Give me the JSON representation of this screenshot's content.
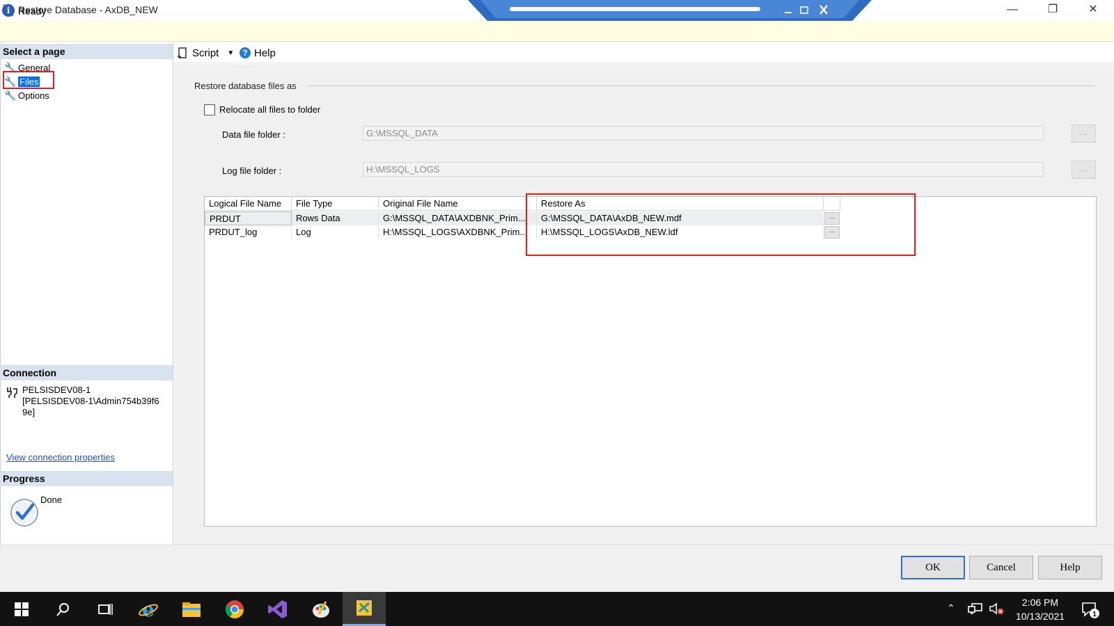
{
  "window": {
    "title": "Restore Database - AxDB_NEW"
  },
  "status": {
    "text": "Ready"
  },
  "left": {
    "select_page_header": "Select a page",
    "pages": [
      "General",
      "Files",
      "Options"
    ],
    "connection_header": "Connection",
    "connection_lines": [
      "PELSISDEV08-1",
      "[PELSISDEV08-1\\Admin754b39f6",
      "9e]"
    ],
    "connection_link": "View connection properties",
    "progress_header": "Progress",
    "progress_text": "Done"
  },
  "toolbar": {
    "script_label": "Script",
    "help_label": "Help"
  },
  "main": {
    "group_label": "Restore database files as",
    "relocate_label": "Relocate all files to folder",
    "data_folder_label": "Data file folder :",
    "data_folder_value": "G:\\MSSQL_DATA",
    "log_folder_label": "Log file folder :",
    "log_folder_value": "H:\\MSSQL_LOGS",
    "browse_label": "...",
    "grid": {
      "columns": [
        "Logical File Name",
        "File Type",
        "Original File Name",
        "Restore As"
      ],
      "rows": [
        [
          "PRDUT",
          "Rows Data",
          "G:\\MSSQL_DATA\\AXDBNK_Prim...",
          "G:\\MSSQL_DATA\\AxDB_NEW.mdf"
        ],
        [
          "PRDUT_log",
          "Log",
          "H:\\MSSQL_LOGS\\AXDBNK_Prim...",
          "H:\\MSSQL_LOGS\\AxDB_NEW.ldf"
        ]
      ]
    }
  },
  "buttons": {
    "ok": "OK",
    "cancel": "Cancel",
    "help": "Help"
  },
  "taskbar": {
    "time": "2:06 PM",
    "date": "10/13/2021",
    "notifications": "1"
  },
  "colors": {
    "accent": "#0f6fd6",
    "highlight": "#e02020",
    "status_bg": "#fffde2"
  }
}
